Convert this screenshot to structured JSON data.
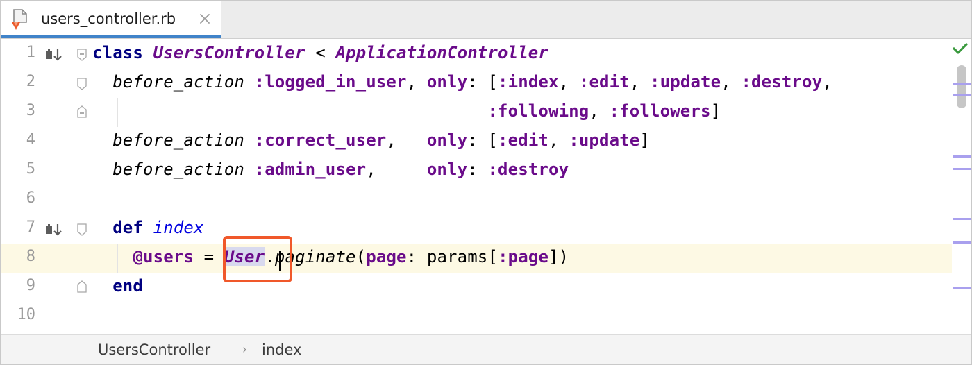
{
  "tab": {
    "title": "users_controller.rb",
    "icon": "ruby-file-icon",
    "close_icon": "close-icon"
  },
  "editor": {
    "lines": [
      {
        "number": "1",
        "text": "class UsersController < ApplicationController"
      },
      {
        "number": "2",
        "text": "  before_action :logged_in_user, only: [:index, :edit, :update, :destroy,"
      },
      {
        "number": "3",
        "text": "                                       :following, :followers]"
      },
      {
        "number": "4",
        "text": "  before_action :correct_user,   only: [:edit, :update]"
      },
      {
        "number": "5",
        "text": "  before_action :admin_user,     only: :destroy"
      },
      {
        "number": "6",
        "text": ""
      },
      {
        "number": "7",
        "text": "  def index"
      },
      {
        "number": "8",
        "text": "    @users = User.paginate(page: params[:page])"
      },
      {
        "number": "9",
        "text": "  end"
      },
      {
        "number": "10",
        "text": ""
      }
    ],
    "current_line": "8",
    "highlighted_token": "User",
    "inspection_status": "check-icon",
    "colors": {
      "keyword": "#000080",
      "symbol": "#6a0b8a",
      "method_name": "#0000e0",
      "current_line_bg": "#fdf9e4",
      "highlight_box": "#f0582a",
      "tab_underline": "#4083c9",
      "marker": "#a9a0ee",
      "check": "#3a9a3e"
    }
  },
  "breadcrumbs": {
    "items": [
      "UsersController",
      "index"
    ],
    "separator": "›"
  }
}
